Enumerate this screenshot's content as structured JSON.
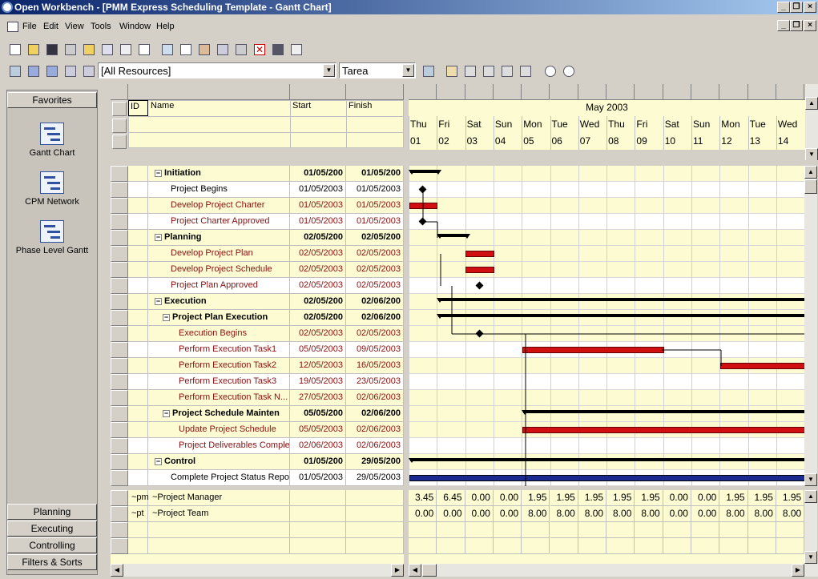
{
  "window": {
    "title": "Open Workbench - [PMM Express Scheduling Template - Gantt Chart]"
  },
  "menu": [
    "File",
    "Edit",
    "View",
    "Tools",
    "Window",
    "Help"
  ],
  "toolbar": {
    "resources": "[All Resources]",
    "field": "Tarea"
  },
  "sidebar": {
    "favorites": "Favorites",
    "views": [
      "Gantt Chart",
      "CPM Network",
      "Phase Level Gantt"
    ],
    "groups": [
      "Planning",
      "Executing",
      "Controlling",
      "Filters & Sorts"
    ]
  },
  "columns": {
    "id": "ID",
    "name": "Name",
    "start": "Start",
    "finish": "Finish"
  },
  "timeline": {
    "month": "May 2003",
    "days": [
      {
        "dow": "Thu",
        "d": "01"
      },
      {
        "dow": "Fri",
        "d": "02"
      },
      {
        "dow": "Sat",
        "d": "03"
      },
      {
        "dow": "Sun",
        "d": "04"
      },
      {
        "dow": "Mon",
        "d": "05"
      },
      {
        "dow": "Tue",
        "d": "06"
      },
      {
        "dow": "Wed",
        "d": "07"
      },
      {
        "dow": "Thu",
        "d": "08"
      },
      {
        "dow": "Fri",
        "d": "09"
      },
      {
        "dow": "Sat",
        "d": "10"
      },
      {
        "dow": "Sun",
        "d": "11"
      },
      {
        "dow": "Mon",
        "d": "12"
      },
      {
        "dow": "Tue",
        "d": "13"
      },
      {
        "dow": "Wed",
        "d": "14"
      }
    ]
  },
  "tasks": [
    {
      "name": "Initiation",
      "start": "01/05/200",
      "finish": "01/05/200",
      "level": 1,
      "summary": true
    },
    {
      "name": "Project Begins",
      "start": "01/05/2003",
      "finish": "01/05/2003",
      "level": 2,
      "milestone": true
    },
    {
      "name": "Develop Project Charter",
      "start": "01/05/2003",
      "finish": "01/05/2003",
      "level": 2,
      "red": true
    },
    {
      "name": "Project Charter Approved",
      "start": "01/05/2003",
      "finish": "01/05/2003",
      "level": 2,
      "red": true
    },
    {
      "name": "Planning",
      "start": "02/05/200",
      "finish": "02/05/200",
      "level": 1,
      "summary": true
    },
    {
      "name": "Develop Project Plan",
      "start": "02/05/2003",
      "finish": "02/05/2003",
      "level": 2,
      "red": true
    },
    {
      "name": "Develop Project Schedule",
      "start": "02/05/2003",
      "finish": "02/05/2003",
      "level": 2,
      "red": true
    },
    {
      "name": "Project Plan Approved",
      "start": "02/05/2003",
      "finish": "02/05/2003",
      "level": 2,
      "red": true
    },
    {
      "name": "Execution",
      "start": "02/05/200",
      "finish": "02/06/200",
      "level": 1,
      "summary": true
    },
    {
      "name": "Project Plan Execution",
      "start": "02/05/200",
      "finish": "02/06/200",
      "level": 2,
      "summary": true
    },
    {
      "name": "Execution Begins",
      "start": "02/05/2003",
      "finish": "02/05/2003",
      "level": 3,
      "red": true
    },
    {
      "name": "Perform Execution Task1",
      "start": "05/05/2003",
      "finish": "09/05/2003",
      "level": 3,
      "red": true
    },
    {
      "name": "Perform Execution Task2",
      "start": "12/05/2003",
      "finish": "16/05/2003",
      "level": 3,
      "red": true
    },
    {
      "name": "Perform Execution Task3",
      "start": "19/05/2003",
      "finish": "23/05/2003",
      "level": 3,
      "red": true
    },
    {
      "name": "Perform Execution Task N...",
      "start": "27/05/2003",
      "finish": "02/06/2003",
      "level": 3,
      "red": true
    },
    {
      "name": "Project Schedule Mainten",
      "start": "05/05/200",
      "finish": "02/06/200",
      "level": 2,
      "summary": true
    },
    {
      "name": "Update Project Schedule",
      "start": "05/05/2003",
      "finish": "02/06/2003",
      "level": 3,
      "red": true
    },
    {
      "name": "Project Deliverables Complet",
      "start": "02/06/2003",
      "finish": "02/06/2003",
      "level": 3,
      "red": true
    },
    {
      "name": "Control",
      "start": "01/05/200",
      "finish": "29/05/200",
      "level": 1,
      "summary": true
    },
    {
      "name": "Complete Project Status Report",
      "start": "01/05/2003",
      "finish": "29/05/2003",
      "level": 2
    }
  ],
  "resources": [
    {
      "id": "~pm",
      "name": "~Project Manager",
      "values": [
        "3.45",
        "6.45",
        "0.00",
        "0.00",
        "1.95",
        "1.95",
        "1.95",
        "1.95",
        "1.95",
        "0.00",
        "0.00",
        "1.95",
        "1.95",
        "1.95"
      ]
    },
    {
      "id": "~pt",
      "name": "~Project Team",
      "values": [
        "0.00",
        "0.00",
        "0.00",
        "0.00",
        "8.00",
        "8.00",
        "8.00",
        "8.00",
        "8.00",
        "0.00",
        "0.00",
        "8.00",
        "8.00",
        "8.00"
      ]
    }
  ]
}
